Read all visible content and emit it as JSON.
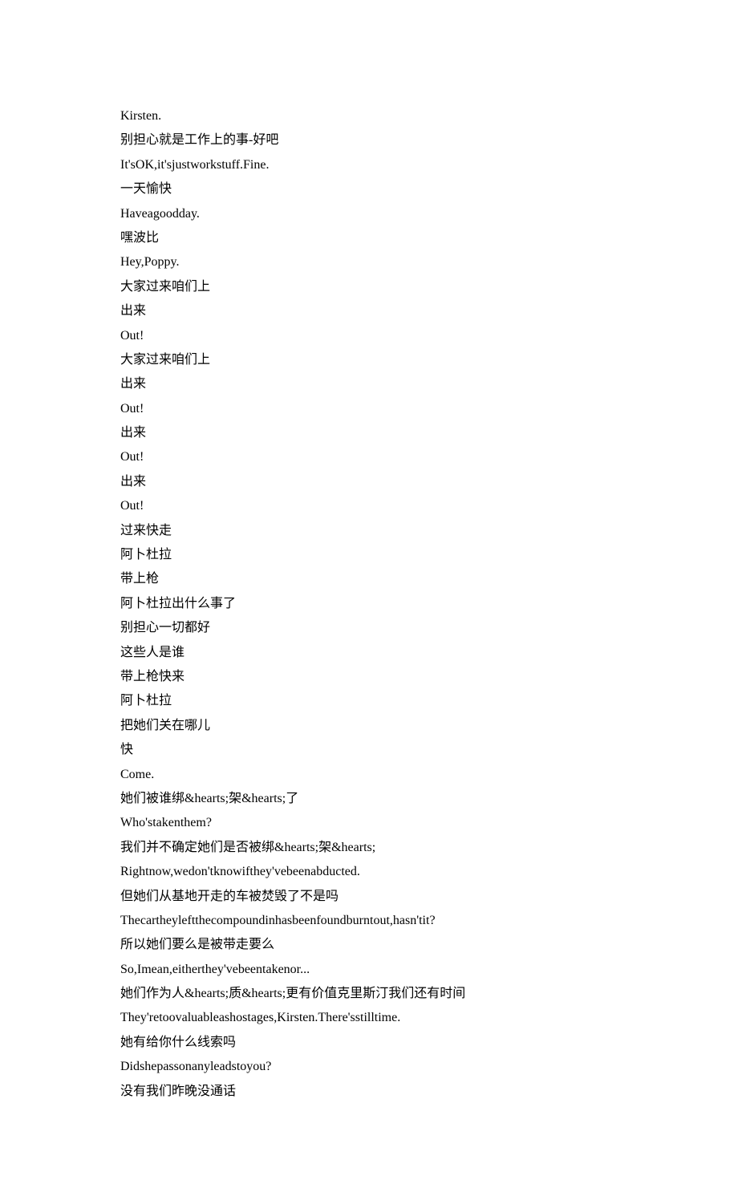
{
  "lines": [
    "Kirsten.",
    "别担心就是工作上的事-好吧",
    "It'sOK,it'sjustworkstuff.Fine.",
    "一天愉快",
    "Haveagoodday.",
    "嘿波比",
    "Hey,Poppy.",
    "大家过来咱们上",
    "出来",
    "Out!",
    "大家过来咱们上",
    "出来",
    "Out!",
    "出来",
    "Out!",
    "出来",
    "Out!",
    "过来快走",
    "阿卜杜拉",
    "带上枪",
    "阿卜杜拉出什么事了",
    "别担心一切都好",
    "这些人是谁",
    "带上枪快来",
    "阿卜杜拉",
    "把她们关在哪儿",
    "快",
    "Come.",
    "她们被谁绑&hearts;架&hearts;了",
    "Who'stakenthem?",
    "我们并不确定她们是否被绑&hearts;架&hearts;",
    "Rightnow,wedon'tknowifthey'vebeenabducted.",
    "但她们从基地开走的车被焚毁了不是吗",
    "Thecartheyleftthecompoundinhasbeenfoundburntout,hasn'tit?",
    "所以她们要么是被带走要么",
    "So,Imean,eitherthey'vebeentakenor...",
    "她们作为人&hearts;质&hearts;更有价值克里斯汀我们还有时间",
    "They'retoovaluableashostages,Kirsten.There'sstilltime.",
    "她有给你什么线索吗",
    "Didshepassonanyleadstoyou?",
    "没有我们昨晚没通话"
  ]
}
